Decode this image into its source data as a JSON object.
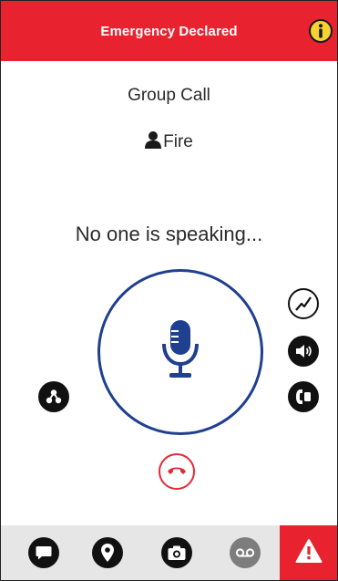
{
  "colors": {
    "header_background": "#e8222e",
    "emergency_red": "#e8222e",
    "ptt_blue": "#1f3f8f",
    "end_call_red": "#e02a35",
    "info_yellow": "#f6d233",
    "bottom_bar_gray": "#e6e6e6",
    "voicemail_gray": "#7d7d7d"
  },
  "header": {
    "title": "Emergency Declared",
    "info_icon": "info-icon"
  },
  "call": {
    "type": "Group Call",
    "group_icon": "person-icon",
    "group_name": "Fire",
    "status": "No one is speaking...",
    "mic_icon": "microphone-icon",
    "end_call_icon": "hang-up-icon"
  },
  "side_controls": {
    "left": [
      "location-share-icon"
    ],
    "right": [
      "signal-icon",
      "speaker-icon",
      "earpiece-icon"
    ]
  },
  "bottom_tabs": [
    "chat-icon",
    "map-pin-icon",
    "camera-icon",
    "voicemail-icon",
    "emergency-warning-icon"
  ]
}
